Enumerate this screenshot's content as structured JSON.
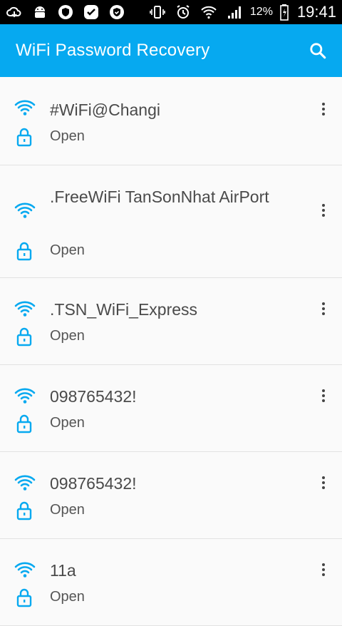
{
  "status_bar": {
    "battery_pct": "12%",
    "time": "19:41"
  },
  "app_bar": {
    "title": "WiFi Password Recovery",
    "accent": "#06a9f0"
  },
  "networks": [
    {
      "ssid": "#WiFi@Changi",
      "security": "Open"
    },
    {
      "ssid": ".FreeWiFi TanSonNhat AirPort",
      "security": "Open"
    },
    {
      "ssid": ".TSN_WiFi_Express",
      "security": "Open"
    },
    {
      "ssid": "098765432!",
      "security": "Open"
    },
    {
      "ssid": "098765432!",
      "security": "Open"
    },
    {
      "ssid": "11a",
      "security": "Open"
    }
  ]
}
